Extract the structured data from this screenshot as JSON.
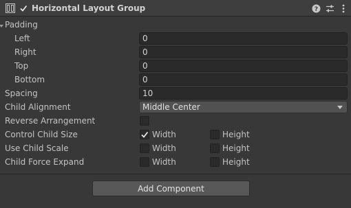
{
  "header": {
    "title": "Horizontal Layout Group",
    "enabled": true,
    "icons": [
      "layout-group-icon",
      "help-icon",
      "presets-icon",
      "context-menu-icon"
    ]
  },
  "padding": {
    "label": "Padding",
    "left_label": "Left",
    "left_value": "0",
    "right_label": "Right",
    "right_value": "0",
    "top_label": "Top",
    "top_value": "0",
    "bottom_label": "Bottom",
    "bottom_value": "0"
  },
  "spacing": {
    "label": "Spacing",
    "value": "10"
  },
  "child_alignment": {
    "label": "Child Alignment",
    "value": "Middle Center"
  },
  "reverse_arrangement": {
    "label": "Reverse Arrangement",
    "checked": false
  },
  "control_child_size": {
    "label": "Control Child Size",
    "width_label": "Width",
    "width_checked": true,
    "height_label": "Height",
    "height_checked": false
  },
  "use_child_scale": {
    "label": "Use Child Scale",
    "width_label": "Width",
    "width_checked": false,
    "height_label": "Height",
    "height_checked": false
  },
  "child_force_expand": {
    "label": "Child Force Expand",
    "width_label": "Width",
    "width_checked": false,
    "height_label": "Height",
    "height_checked": false
  },
  "add_component": {
    "label": "Add Component"
  }
}
